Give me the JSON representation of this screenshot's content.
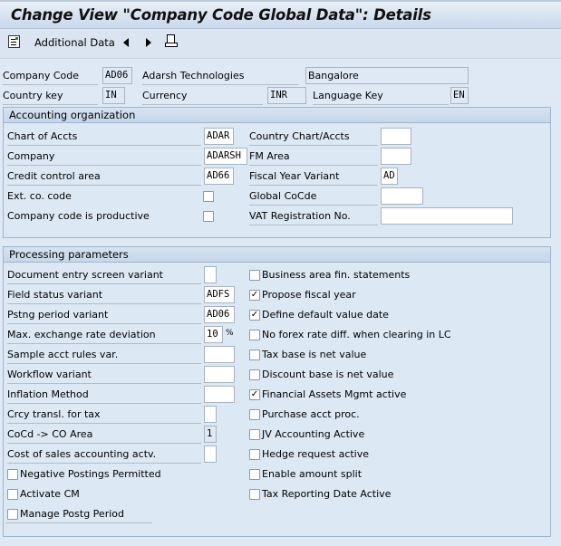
{
  "title": "Change View \"Company Code Global Data\": Details",
  "toolbar": {
    "additional_data": "Additional Data",
    "icons": [
      "details-list-icon",
      "previous-arrow-icon",
      "next-arrow-icon",
      "print-icon"
    ]
  },
  "header": {
    "company_code_label": "Company Code",
    "company_code": "AD06",
    "company_name": "Adarsh Technologies",
    "city": "Bangalore",
    "country_key_label": "Country key",
    "country_key": "IN",
    "currency_label": "Currency",
    "currency": "INR",
    "language_key_label": "Language Key",
    "language_key": "EN"
  },
  "accounting_org": {
    "title": "Accounting organization",
    "left": [
      {
        "label": "Chart of Accts",
        "type": "input",
        "value": "ADAR"
      },
      {
        "label": "Company",
        "type": "input",
        "value": "ADARSH"
      },
      {
        "label": "Credit control area",
        "type": "input",
        "value": "AD66"
      },
      {
        "label": "Ext. co. code",
        "type": "checkbox",
        "checked": false
      },
      {
        "label": "Company code is productive",
        "type": "checkbox",
        "checked": false
      }
    ],
    "right": [
      {
        "label": "Country Chart/Accts",
        "value": ""
      },
      {
        "label": "FM Area",
        "value": ""
      },
      {
        "label": "Fiscal Year Variant",
        "value": "AD"
      },
      {
        "label": "Global CoCde",
        "value": ""
      },
      {
        "label": "VAT Registration No.",
        "value": ""
      }
    ]
  },
  "processing": {
    "title": "Processing parameters",
    "left": [
      {
        "label": "Document entry screen variant",
        "type": "input",
        "value": ""
      },
      {
        "label": "Field status variant",
        "type": "input",
        "value": "ADFS"
      },
      {
        "label": "Pstng period variant",
        "type": "input",
        "value": "AD06"
      },
      {
        "label": "Max. exchange rate deviation",
        "type": "input",
        "value": "10",
        "unit": "%"
      },
      {
        "label": "Sample acct rules var.",
        "type": "input",
        "value": ""
      },
      {
        "label": "Workflow variant",
        "type": "input",
        "value": ""
      },
      {
        "label": "Inflation Method",
        "type": "input",
        "value": ""
      },
      {
        "label": "Crcy transl. for tax",
        "type": "input",
        "value": ""
      },
      {
        "label": "CoCd -> CO Area",
        "type": "input",
        "value": "1",
        "readonly": true
      },
      {
        "label": "Cost of sales accounting actv.",
        "type": "input",
        "value": ""
      },
      {
        "label": "Negative Postings Permitted",
        "type": "checkbox",
        "checked": false
      },
      {
        "label": "Activate CM",
        "type": "checkbox",
        "checked": false
      },
      {
        "label": "Manage Postg Period",
        "type": "checkbox",
        "checked": false
      }
    ],
    "right": [
      {
        "label": "Business area fin. statements",
        "checked": false
      },
      {
        "label": "Propose fiscal year",
        "checked": true
      },
      {
        "label": "Define default value date",
        "checked": true
      },
      {
        "label": "No forex rate diff. when clearing in LC",
        "checked": false
      },
      {
        "label": "Tax base is net value",
        "checked": false
      },
      {
        "label": "Discount base is net value",
        "checked": false
      },
      {
        "label": "Financial Assets Mgmt active",
        "checked": true
      },
      {
        "label": "Purchase acct proc.",
        "checked": false
      },
      {
        "label": "JV Accounting Active",
        "checked": false
      },
      {
        "label": "Hedge request active",
        "checked": false
      },
      {
        "label": "Enable amount split",
        "checked": false
      },
      {
        "label": "Tax Reporting Date Active",
        "checked": false
      }
    ]
  }
}
